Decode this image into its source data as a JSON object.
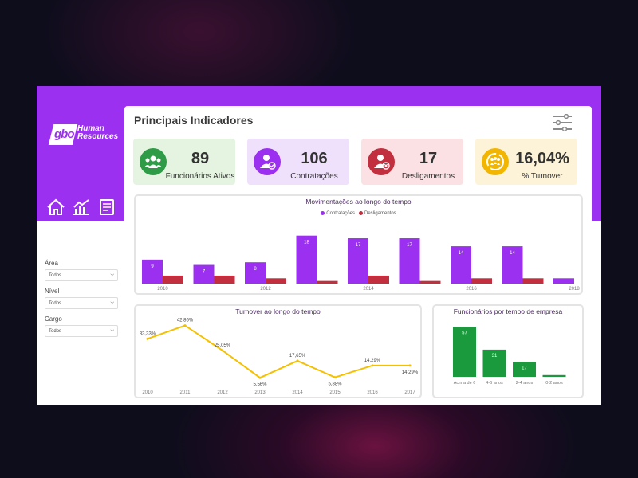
{
  "brand": {
    "logo_text": "gbo",
    "logo_tagline": "Human Resources"
  },
  "page_title": "Principais Indicadores",
  "filters": [
    {
      "label": "Área",
      "value": "Todos"
    },
    {
      "label": "Nível",
      "value": "Todos"
    },
    {
      "label": "Cargo",
      "value": "Todos"
    }
  ],
  "kpis": [
    {
      "value": "89",
      "label": "Funcionários Ativos",
      "bg": "#e4f4e1",
      "icon_bg": "#2e9c47",
      "icon": "people-group-icon"
    },
    {
      "value": "106",
      "label": "Contratações",
      "bg": "#efe0fb",
      "icon_bg": "#9b30f0",
      "icon": "user-check-icon"
    },
    {
      "value": "17",
      "label": "Desligamentos",
      "bg": "#fbe1e3",
      "icon_bg": "#c22f3e",
      "icon": "user-remove-icon"
    },
    {
      "value": "16,04%",
      "label": "% Turnover",
      "bg": "#fdf3d8",
      "icon_bg": "#f2b600",
      "icon": "turnover-cycle-icon"
    }
  ],
  "colors": {
    "purple": "#9b30f0",
    "red": "#c22f3e",
    "yellow": "#f5c000",
    "green": "#1a9a3c"
  },
  "chart_data": [
    {
      "type": "bar",
      "title": "Movimentações ao longo do tempo",
      "categories": [
        "2010",
        "2011",
        "2012",
        "2013",
        "2014",
        "2015",
        "2016",
        "2017",
        "2018"
      ],
      "tick_labels": [
        "2010",
        "",
        "2012",
        "",
        "2014",
        "",
        "2016",
        "",
        "2018"
      ],
      "series": [
        {
          "name": "Contratações",
          "values": [
            9,
            7,
            8,
            18,
            17,
            17,
            14,
            14,
            2
          ]
        },
        {
          "name": "Desligamentos",
          "values": [
            3,
            3,
            2,
            1,
            3,
            1,
            2,
            2,
            0
          ]
        }
      ],
      "data_labels": [
        "9",
        "7",
        "8",
        "18",
        "17",
        "17",
        "14",
        "14",
        ""
      ],
      "ylim": [
        0,
        20
      ]
    },
    {
      "type": "line",
      "title": "Turnover ao longo do tempo",
      "x": [
        "2010",
        "2011",
        "2012",
        "2013",
        "2014",
        "2015",
        "2016",
        "2017"
      ],
      "values": [
        33.33,
        42.86,
        25.05,
        5.56,
        17.65,
        5.88,
        14.29,
        14.29
      ],
      "labels": [
        "33,33%",
        "42,86%",
        "25,05%",
        "5,56%",
        "17,65%",
        "5,88%",
        "14,29%",
        "14,29%"
      ],
      "ylim": [
        0,
        50
      ]
    },
    {
      "type": "bar",
      "title": "Funcionários por tempo de empresa",
      "categories": [
        "Acima de 6 anos",
        "4-6 anos",
        "2-4 anos",
        "0-2 anos"
      ],
      "values": [
        57,
        31,
        17,
        2
      ],
      "data_labels": [
        "57",
        "31",
        "17",
        ""
      ],
      "ylim": [
        0,
        60
      ]
    }
  ]
}
